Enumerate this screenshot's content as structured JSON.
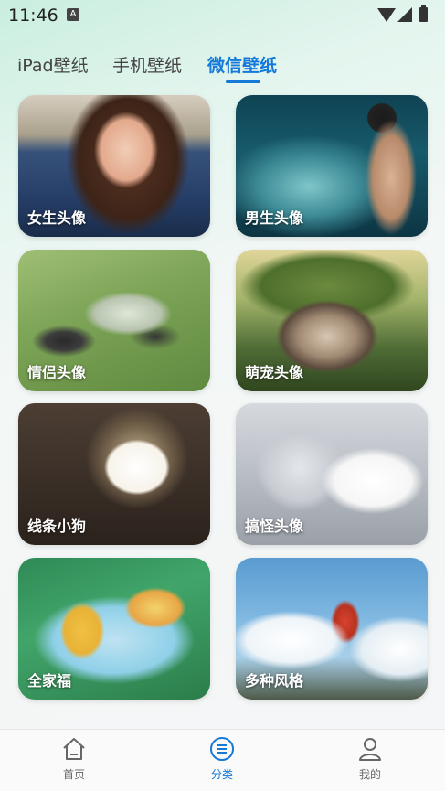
{
  "status_bar": {
    "time": "11:46",
    "notif_icon": "a-app-icon"
  },
  "tabs": [
    {
      "label": "iPad壁纸",
      "active": false
    },
    {
      "label": "手机壁纸",
      "active": false
    },
    {
      "label": "微信壁纸",
      "active": true
    }
  ],
  "cards": [
    {
      "label": "女生头像"
    },
    {
      "label": "男生头像"
    },
    {
      "label": "情侣头像"
    },
    {
      "label": "萌宠头像"
    },
    {
      "label": "线条小狗"
    },
    {
      "label": "搞怪头像"
    },
    {
      "label": "全家福"
    },
    {
      "label": "多种风格"
    }
  ],
  "bottom_nav": [
    {
      "label": "首页",
      "icon": "home-icon",
      "active": false
    },
    {
      "label": "分类",
      "icon": "category-icon",
      "active": true
    },
    {
      "label": "我的",
      "icon": "profile-icon",
      "active": false
    }
  ],
  "colors": {
    "accent": "#1479d8"
  }
}
